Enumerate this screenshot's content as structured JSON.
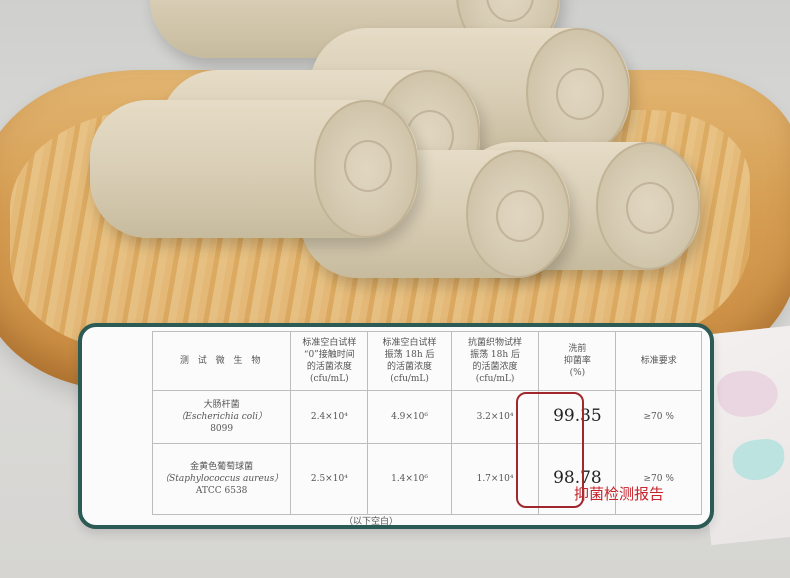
{
  "table": {
    "headers": [
      "测 试 微 生 物",
      "标准空白试样\n“0”接触时间\n的活菌浓度\n(cfu/mL)",
      "标准空白试样\n振荡 18h 后\n的活菌浓度\n(cfu/mL)",
      "抗菌织物试样\n振荡 18h 后\n的活菌浓度\n(cfu/mL)",
      "洗前\n抑菌率\n(%)",
      "标准要求"
    ],
    "rows": [
      {
        "organism_cn": "大肠杆菌",
        "organism_latin": "（Escherichia coli）",
        "strain": "8099",
        "blank_0h": "2.4×10⁴",
        "blank_18h": "4.9×10⁶",
        "fabric_18h": "3.2×10⁴",
        "rate": "99.35",
        "requirement": "≥70 %"
      },
      {
        "organism_cn": "金黄色葡萄球菌",
        "organism_latin": "（Staphylococcus aureus）",
        "strain": "ATCC 6538",
        "blank_0h": "2.5×10⁴",
        "blank_18h": "1.4×10⁶",
        "fabric_18h": "1.7×10⁴",
        "rate": "98.78",
        "requirement": "≥70 %"
      }
    ],
    "footer": "（以下空白）"
  },
  "stamp_label": "抑菌检测报告",
  "colors": {
    "frame": "#2c5a55",
    "highlight": "#a0282d",
    "stamp": "#c8242c"
  }
}
